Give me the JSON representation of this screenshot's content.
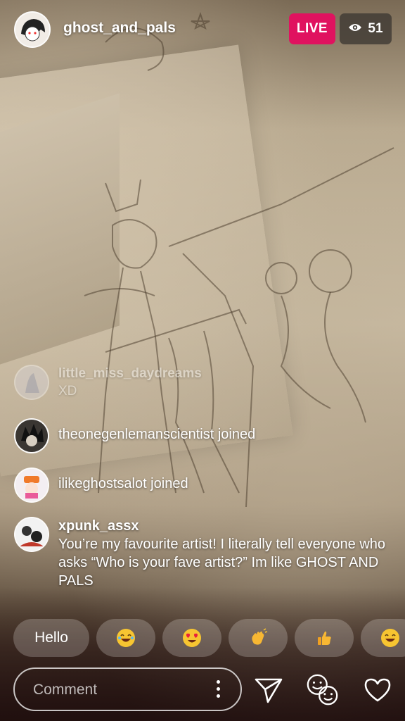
{
  "header": {
    "host_name": "ghost_and_pals",
    "live_label": "LIVE",
    "viewer_count": "51"
  },
  "comments": [
    {
      "username": "little_miss_daydreams",
      "text": "XD"
    },
    {
      "username": "",
      "text": "theonegenlemanscientist joined"
    },
    {
      "username": "",
      "text": "ilikeghostsalot joined"
    },
    {
      "username": "xpunk_assx",
      "text": "You’re my favourite artist! I literally tell everyone who asks “Who is your fave artist?” Im like GHOST AND PALS"
    }
  ],
  "quick_replies": {
    "hello": "Hello",
    "items": [
      "laughing-emoji",
      "heart-eyes-emoji",
      "waving-hand-emoji",
      "thumbs-up-emoji",
      "laughing-emoji"
    ]
  },
  "composer": {
    "placeholder": "Comment"
  },
  "colors": {
    "live": "#e0125f",
    "viewer_badge": "#3c3732"
  }
}
